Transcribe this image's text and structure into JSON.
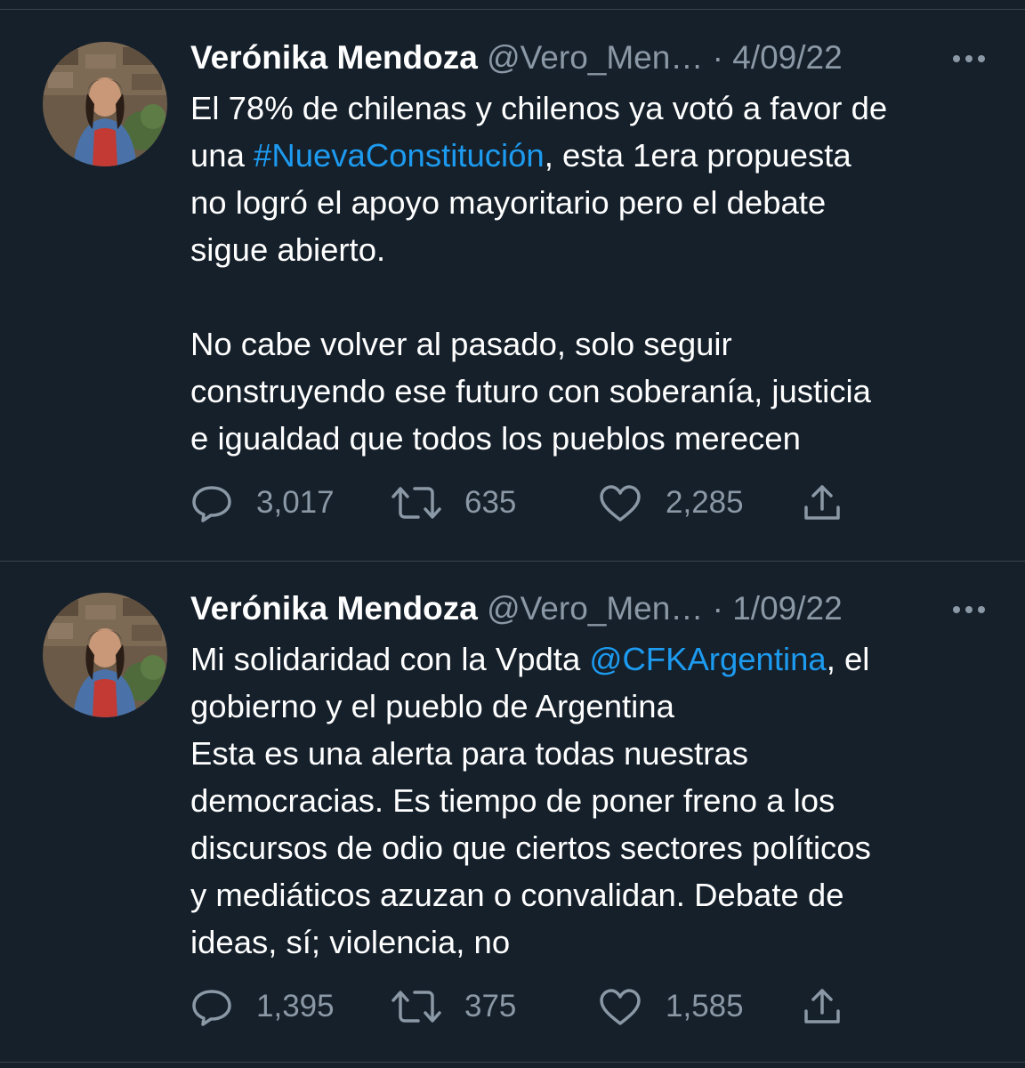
{
  "tweets": [
    {
      "author_name": "Verónika Mendoza",
      "handle": "@Vero_Men…",
      "separator": " · ",
      "date": "4/09/22",
      "text": {
        "part1": "El 78% de chilenas y chilenos ya votó a favor de\nuna ",
        "hashtag": "#NuevaConstitución",
        "part2": ", esta 1era propuesta\nno logró el apoyo mayoritario pero el debate\nsigue abierto.\n\nNo cabe volver al pasado, solo seguir\nconstruyendo ese futuro con soberanía, justicia\ne igualdad que todos los pueblos merecen"
      },
      "replies": "3,017",
      "retweets": "635",
      "likes": "2,285"
    },
    {
      "author_name": "Verónika Mendoza",
      "handle": "@Vero_Men…",
      "separator": " · ",
      "date": "1/09/22",
      "text": {
        "part1": "Mi solidaridad con la Vpdta ",
        "mention": "@CFKArgentina",
        "part2": ", el\ngobierno y el pueblo de Argentina\nEsta es una alerta para todas nuestras\ndemocracias. Es tiempo de poner freno a los\ndiscursos de odio que ciertos sectores políticos\ny mediáticos azuzan o convalidan. Debate de\nideas, sí; violencia, no"
      },
      "replies": "1,395",
      "retweets": "375",
      "likes": "1,585"
    }
  ],
  "icons": {
    "reply": "reply-icon",
    "retweet": "retweet-icon",
    "like": "heart-icon",
    "share": "share-icon",
    "more": "more-icon"
  },
  "colors": {
    "background": "#15202b",
    "text": "#ffffff",
    "secondary": "#8b98a5",
    "link": "#1d9bf0",
    "divider": "#38444d"
  }
}
